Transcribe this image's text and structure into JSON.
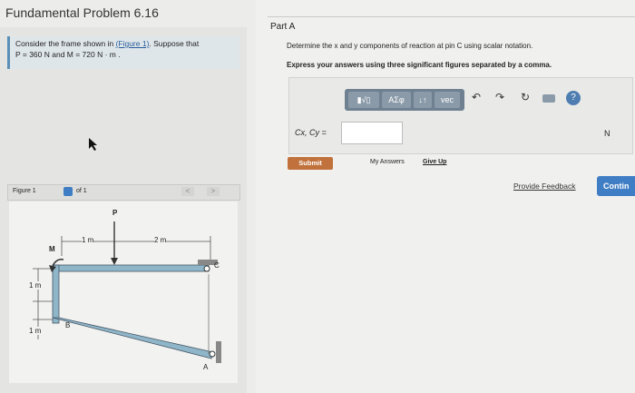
{
  "title": "Fundamental Problem 6.16",
  "problem": {
    "line1_pre": "Consider the frame shown in ",
    "figure_link": "(Figure 1)",
    "line1_post": ". Suppose that",
    "line2": "P = 360  N and M = 720  N · m ."
  },
  "figure_panel": {
    "label": "Figure 1",
    "of": "of 1",
    "prev": "<",
    "next": ">",
    "labels": {
      "P": "P",
      "M": "M",
      "C": "C",
      "B": "B",
      "A": "A",
      "dim1": "1 m",
      "dim2": "2 m",
      "dim3": "1 m",
      "dim4": "1 m"
    }
  },
  "part": {
    "title": "Part A",
    "question": "Determine the x and y components of reaction at pin C using scalar notation.",
    "instruction": "Express your answers using three significant figures separated by a comma.",
    "toolbar": {
      "templates": "▮√▯",
      "greek": "ΑΣφ",
      "arrows": "↓↑",
      "vec": "vec"
    },
    "input_label": "Cx, Cy =",
    "input_value": "",
    "unit": "N",
    "help": "?"
  },
  "submit_label": "Submit",
  "my_answers": "My Answers",
  "give_up": "Give Up",
  "feedback": "Provide Feedback",
  "continue": "Contin"
}
